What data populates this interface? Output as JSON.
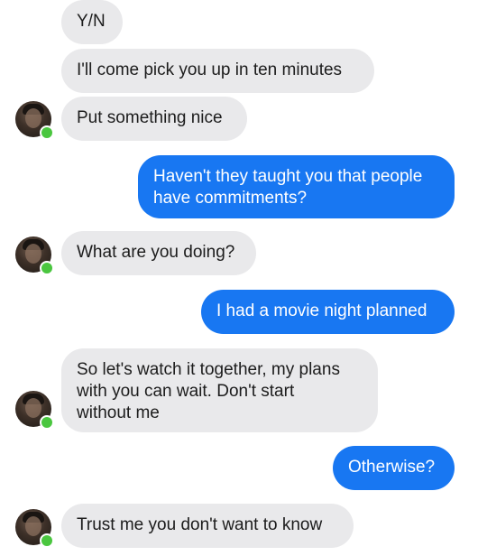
{
  "conversation": {
    "messages": [
      {
        "text": "Y/N",
        "direction": "incoming"
      },
      {
        "text": "I'll come pick you up in ten minutes",
        "direction": "incoming"
      },
      {
        "text": "Put something nice",
        "direction": "incoming"
      },
      {
        "text": "Haven't they taught you that people\nhave commitments?",
        "direction": "outgoing"
      },
      {
        "text": "What are you doing?",
        "direction": "incoming"
      },
      {
        "text": "I had a movie night planned",
        "direction": "outgoing"
      },
      {
        "text": "So let's watch it together, my plans\nwith you can wait. Don't start\nwithout me",
        "direction": "incoming"
      },
      {
        "text": "Otherwise?",
        "direction": "outgoing"
      },
      {
        "text": "Trust me you don't want to know",
        "direction": "incoming"
      }
    ]
  },
  "colors": {
    "incoming_bubble": "#e9e9eb",
    "outgoing_bubble": "#1877f2",
    "online_indicator": "#4ac63f"
  },
  "icons": {
    "avatar": "contact-avatar",
    "online": "online-status-dot"
  }
}
